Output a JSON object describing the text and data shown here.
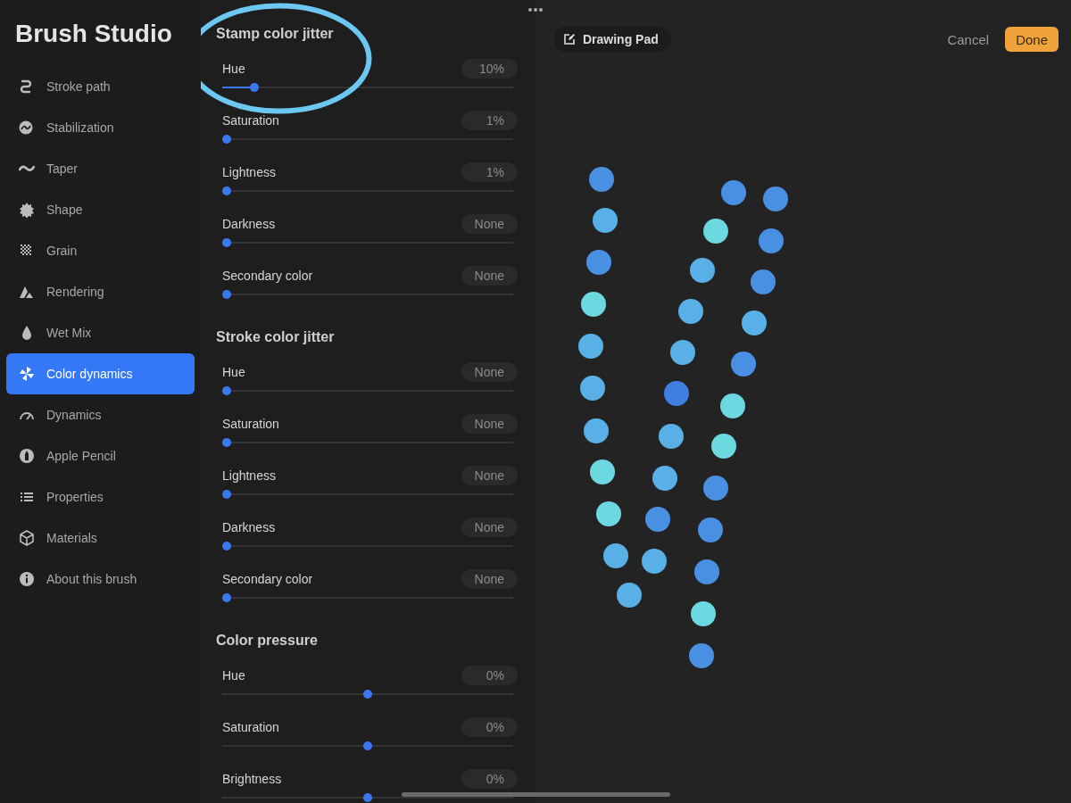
{
  "sidebar": {
    "title": "Brush Studio",
    "items": [
      {
        "label": "Stroke path",
        "selected": false
      },
      {
        "label": "Stabilization",
        "selected": false
      },
      {
        "label": "Taper",
        "selected": false
      },
      {
        "label": "Shape",
        "selected": false
      },
      {
        "label": "Grain",
        "selected": false
      },
      {
        "label": "Rendering",
        "selected": false
      },
      {
        "label": "Wet Mix",
        "selected": false
      },
      {
        "label": "Color dynamics",
        "selected": true
      },
      {
        "label": "Dynamics",
        "selected": false
      },
      {
        "label": "Apple Pencil",
        "selected": false
      },
      {
        "label": "Properties",
        "selected": false
      },
      {
        "label": "Materials",
        "selected": false
      },
      {
        "label": "About this brush",
        "selected": false
      }
    ]
  },
  "sections": [
    {
      "title": "Stamp color jitter",
      "kind": "unipolar",
      "rows": [
        {
          "label": "Hue",
          "value": "10%",
          "level": 0.11
        },
        {
          "label": "Saturation",
          "value": "1%",
          "level": 0.01
        },
        {
          "label": "Lightness",
          "value": "1%",
          "level": 0.01
        },
        {
          "label": "Darkness",
          "value": "None",
          "level": 0
        },
        {
          "label": "Secondary color",
          "value": "None",
          "level": 0
        }
      ]
    },
    {
      "title": "Stroke color jitter",
      "kind": "unipolar",
      "rows": [
        {
          "label": "Hue",
          "value": "None",
          "level": 0
        },
        {
          "label": "Saturation",
          "value": "None",
          "level": 0
        },
        {
          "label": "Lightness",
          "value": "None",
          "level": 0
        },
        {
          "label": "Darkness",
          "value": "None",
          "level": 0
        },
        {
          "label": "Secondary color",
          "value": "None",
          "level": 0
        }
      ]
    },
    {
      "title": "Color pressure",
      "kind": "bipolar",
      "rows": [
        {
          "label": "Hue",
          "value": "0%",
          "level": 0.5
        },
        {
          "label": "Saturation",
          "value": "0%",
          "level": 0.5
        },
        {
          "label": "Brightness",
          "value": "0%",
          "level": 0.5
        }
      ]
    }
  ],
  "highlight_ellipse": true,
  "pad": {
    "title": "Drawing Pad",
    "cancel": "Cancel",
    "done": "Done"
  }
}
